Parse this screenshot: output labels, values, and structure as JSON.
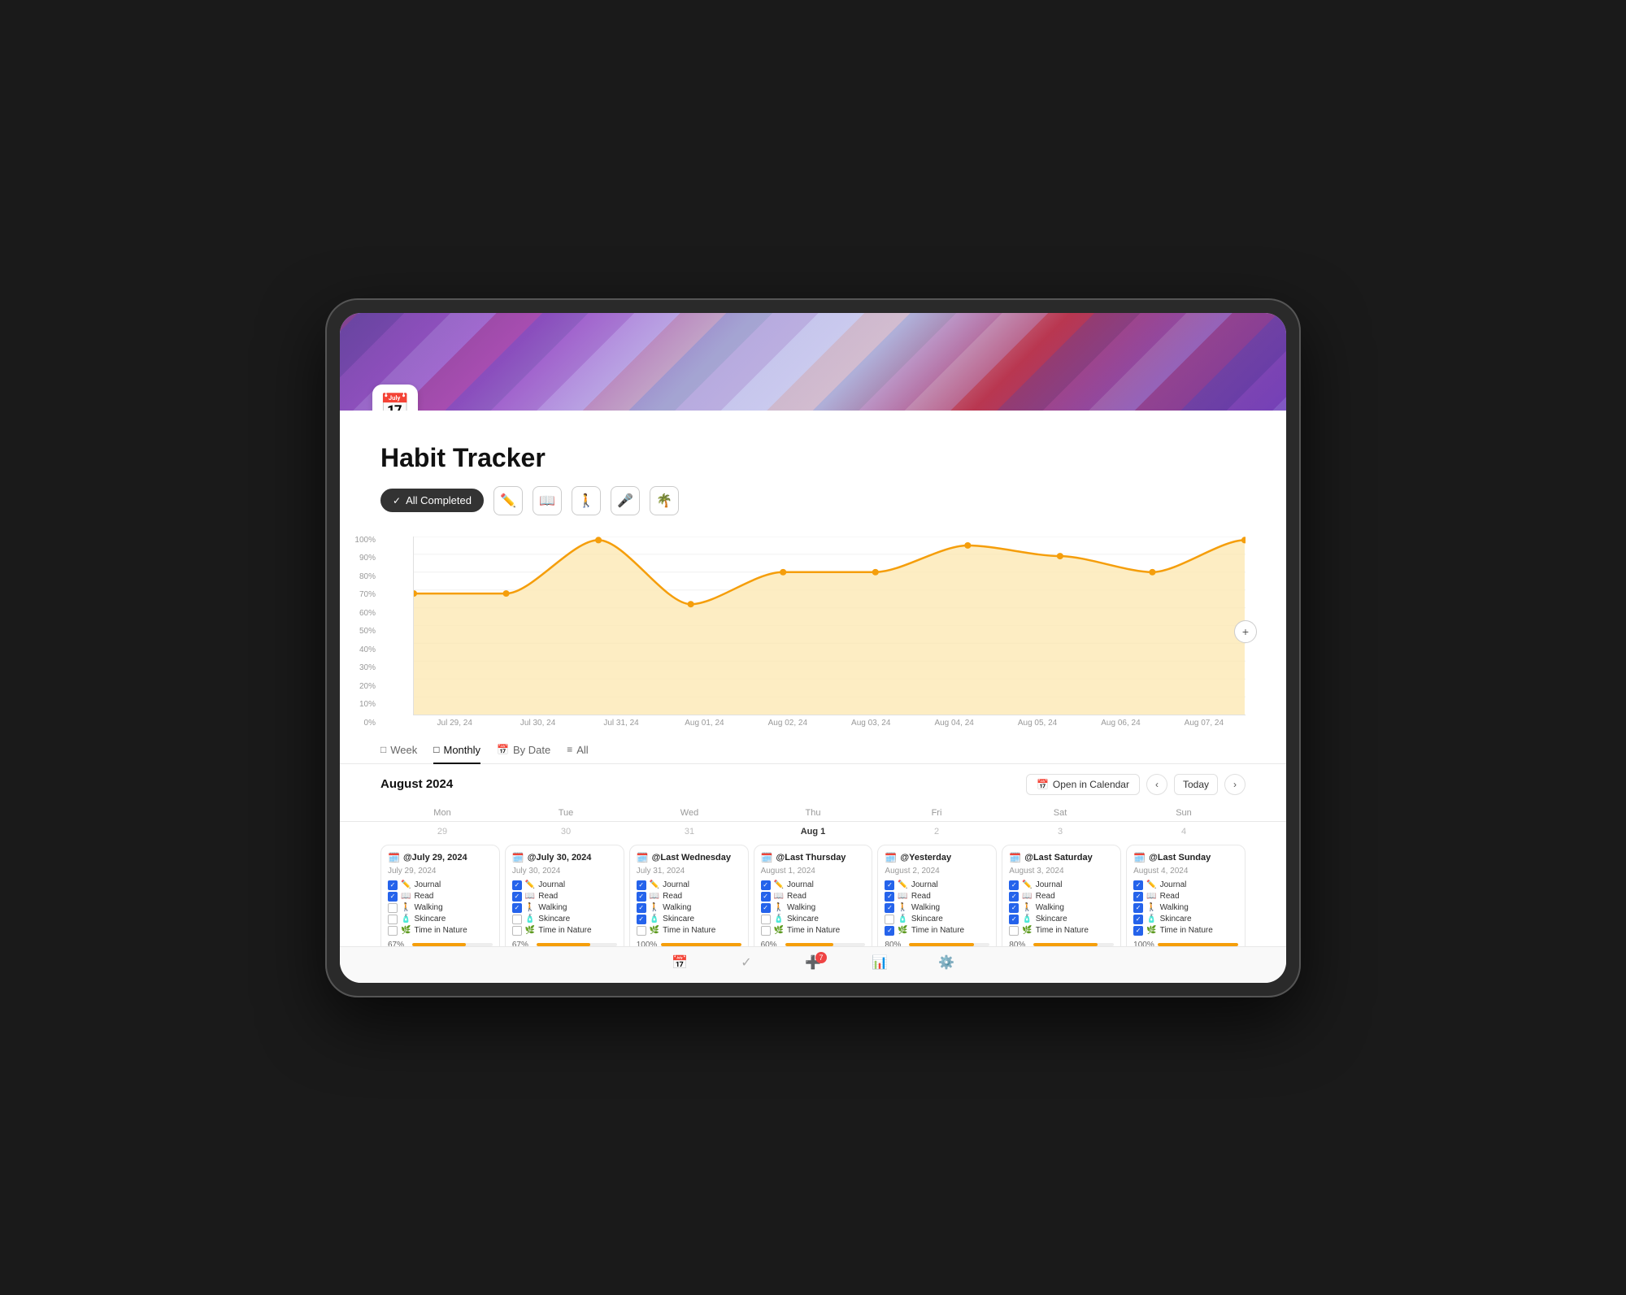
{
  "app": {
    "title": "Habit Tracker",
    "icon": "📅"
  },
  "filters": [
    {
      "id": "all-completed",
      "label": "All Completed",
      "active": true,
      "icon": "✓"
    },
    {
      "id": "journal",
      "label": "journal-icon",
      "icon": "✏️"
    },
    {
      "id": "read",
      "label": "read-icon",
      "icon": "📖"
    },
    {
      "id": "walking",
      "label": "walking-icon",
      "icon": "🚶"
    },
    {
      "id": "skincare",
      "label": "skincare-icon",
      "icon": "🎤"
    },
    {
      "id": "nature",
      "label": "nature-icon",
      "icon": "🌴"
    }
  ],
  "chart": {
    "yLabels": [
      "100%",
      "90%",
      "80%",
      "70%",
      "60%",
      "50%",
      "40%",
      "30%",
      "20%",
      "10%",
      "0%"
    ],
    "xLabels": [
      "Jul 29, 24",
      "Jul 30, 24",
      "Jul 31, 24",
      "Aug 01, 24",
      "Aug 02, 24",
      "Aug 03, 24",
      "Aug 04, 24",
      "Aug 05, 24",
      "Aug 06, 24",
      "Aug 07, 24"
    ],
    "dataPoints": [
      68,
      68,
      98,
      62,
      80,
      80,
      95,
      92,
      80,
      98
    ]
  },
  "tabs": [
    {
      "id": "week",
      "label": "Week",
      "icon": "□",
      "active": false
    },
    {
      "id": "monthly",
      "label": "Monthly",
      "icon": "□",
      "active": true
    },
    {
      "id": "by-date",
      "label": "By Date",
      "icon": "📅",
      "active": false
    },
    {
      "id": "all",
      "label": "All",
      "icon": "≡",
      "active": false
    }
  ],
  "calendar": {
    "month": "August 2024",
    "openBtnLabel": "Open in Calendar",
    "todayBtnLabel": "Today",
    "weekdays": [
      "Mon",
      "Tue",
      "Wed",
      "Thu",
      "Fri",
      "Sat",
      "Sun"
    ],
    "weekNumbers": [
      29,
      30,
      31,
      "Aug 1",
      2,
      3,
      4
    ],
    "days": [
      {
        "flag": "🗓️",
        "title": "@July 29, 2024",
        "date": "July 29, 2024",
        "habits": [
          {
            "checked": true,
            "icon": "✏️",
            "label": "Journal"
          },
          {
            "checked": true,
            "icon": "📖",
            "label": "Read"
          },
          {
            "checked": false,
            "icon": "🚶",
            "label": "Walking"
          },
          {
            "checked": false,
            "icon": "🧴",
            "label": "Skincare"
          },
          {
            "checked": false,
            "icon": "🌿",
            "label": "Time in Nature"
          }
        ],
        "progress": 67,
        "complete": true
      },
      {
        "flag": "🗓️",
        "title": "@July 30, 2024",
        "date": "July 30, 2024",
        "habits": [
          {
            "checked": true,
            "icon": "✏️",
            "label": "Journal"
          },
          {
            "checked": true,
            "icon": "📖",
            "label": "Read"
          },
          {
            "checked": true,
            "icon": "🚶",
            "label": "Walking"
          },
          {
            "checked": false,
            "icon": "🧴",
            "label": "Skincare"
          },
          {
            "checked": false,
            "icon": "🌿",
            "label": "Time in Nature"
          }
        ],
        "progress": 67,
        "complete": true
      },
      {
        "flag": "🗓️",
        "title": "@Last Wednesday",
        "date": "July 31, 2024",
        "habits": [
          {
            "checked": true,
            "icon": "✏️",
            "label": "Journal"
          },
          {
            "checked": true,
            "icon": "📖",
            "label": "Read"
          },
          {
            "checked": true,
            "icon": "🚶",
            "label": "Walking"
          },
          {
            "checked": true,
            "icon": "🧴",
            "label": "Skincare"
          },
          {
            "checked": false,
            "icon": "🌿",
            "label": "Time in Nature"
          }
        ],
        "progress": 100,
        "complete": true
      },
      {
        "flag": "🗓️",
        "title": "@Last Thursday",
        "date": "August 1, 2024",
        "habits": [
          {
            "checked": true,
            "icon": "✏️",
            "label": "Journal"
          },
          {
            "checked": true,
            "icon": "📖",
            "label": "Read"
          },
          {
            "checked": true,
            "icon": "🚶",
            "label": "Walking"
          },
          {
            "checked": false,
            "icon": "🧴",
            "label": "Skincare"
          },
          {
            "checked": false,
            "icon": "🌿",
            "label": "Time in Nature"
          }
        ],
        "progress": 60,
        "complete": true
      },
      {
        "flag": "🗓️",
        "title": "@Yesterday",
        "date": "August 2, 2024",
        "habits": [
          {
            "checked": true,
            "icon": "✏️",
            "label": "Journal"
          },
          {
            "checked": true,
            "icon": "📖",
            "label": "Read"
          },
          {
            "checked": true,
            "icon": "🚶",
            "label": "Walking"
          },
          {
            "checked": false,
            "icon": "🧴",
            "label": "Skincare"
          },
          {
            "checked": true,
            "icon": "🌿",
            "label": "Time in Nature"
          }
        ],
        "progress": 80,
        "complete": true
      },
      {
        "flag": "🗓️",
        "title": "@Last Saturday",
        "date": "August 3, 2024",
        "habits": [
          {
            "checked": true,
            "icon": "✏️",
            "label": "Journal"
          },
          {
            "checked": true,
            "icon": "📖",
            "label": "Read"
          },
          {
            "checked": true,
            "icon": "🚶",
            "label": "Walking"
          },
          {
            "checked": true,
            "icon": "🧴",
            "label": "Skincare"
          },
          {
            "checked": false,
            "icon": "🌿",
            "label": "Time in Nature"
          }
        ],
        "progress": 80,
        "complete": true
      },
      {
        "flag": "🗓️",
        "title": "@Last Sunday",
        "date": "August 4, 2024",
        "habits": [
          {
            "checked": true,
            "icon": "✏️",
            "label": "Journal"
          },
          {
            "checked": true,
            "icon": "📖",
            "label": "Read"
          },
          {
            "checked": true,
            "icon": "🚶",
            "label": "Walking"
          },
          {
            "checked": true,
            "icon": "🧴",
            "label": "Skincare"
          },
          {
            "checked": true,
            "icon": "🌿",
            "label": "Time in Nature"
          }
        ],
        "progress": 100,
        "complete": true
      }
    ]
  },
  "bottomNav": [
    {
      "id": "calendar",
      "icon": "📅",
      "label": "Calendar",
      "active": false,
      "badge": null
    },
    {
      "id": "habits",
      "icon": "✓",
      "label": "Habits",
      "active": false,
      "badge": null
    },
    {
      "id": "add",
      "icon": "➕",
      "label": "Add",
      "active": false,
      "badge": "7"
    },
    {
      "id": "stats",
      "icon": "📊",
      "label": "Stats",
      "active": false,
      "badge": null
    },
    {
      "id": "settings",
      "icon": "⚙️",
      "label": "Settings",
      "active": false,
      "badge": null
    }
  ]
}
